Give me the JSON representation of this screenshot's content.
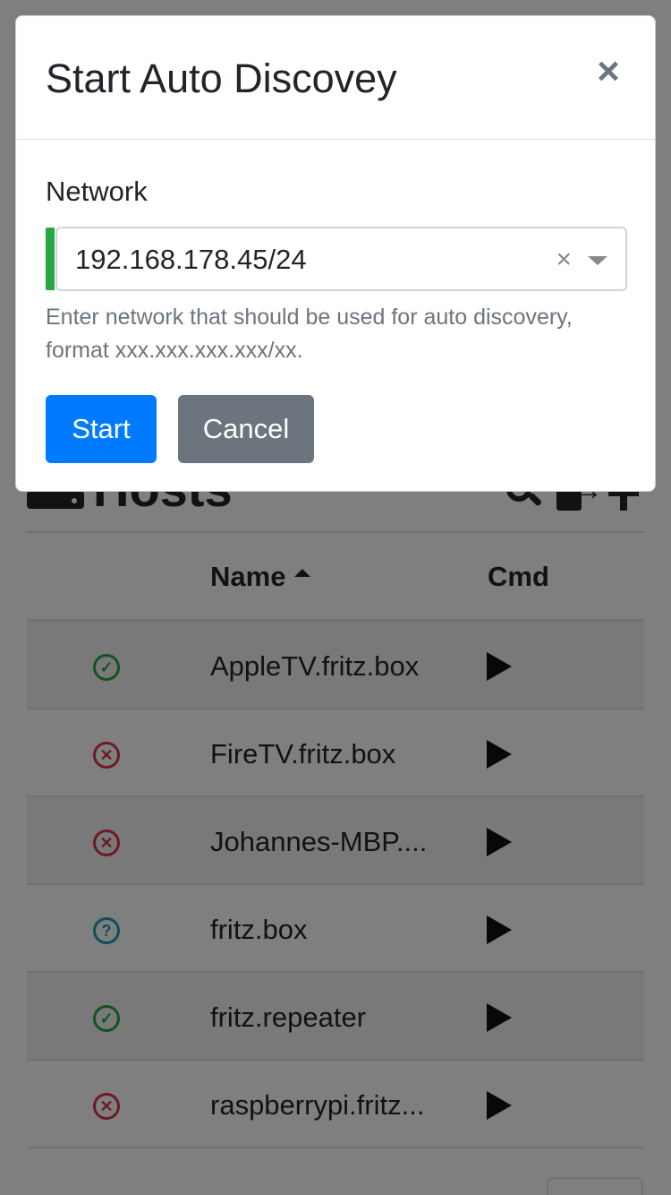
{
  "modal": {
    "title": "Start Auto Discovey",
    "close_label": "×",
    "network_label": "Network",
    "network_value": "192.168.178.45/24",
    "clear_label": "×",
    "help_text": "Enter network that should be used for auto discovery, format xxx.xxx.xxx.xxx/xx.",
    "start_label": "Start",
    "cancel_label": "Cancel"
  },
  "page": {
    "title": "Hosts",
    "columns": {
      "name": "Name",
      "cmd": "Cmd"
    },
    "rows": [
      {
        "name": "AppleTV.fritz.box",
        "status": "ok",
        "status_glyph": "✓"
      },
      {
        "name": "FireTV.fritz.box",
        "status": "error",
        "status_glyph": "✕"
      },
      {
        "name": "Johannes-MBP....",
        "status": "error",
        "status_glyph": "✕"
      },
      {
        "name": "fritz.box",
        "status": "unknown",
        "status_glyph": "?"
      },
      {
        "name": "fritz.repeater",
        "status": "ok",
        "status_glyph": "✓"
      },
      {
        "name": "raspberrypi.fritz...",
        "status": "error",
        "status_glyph": "✕"
      }
    ]
  },
  "colors": {
    "primary": "#007bff",
    "secondary": "#6c757d",
    "success": "#28a745",
    "danger": "#dc3545",
    "info": "#17a2b8"
  }
}
